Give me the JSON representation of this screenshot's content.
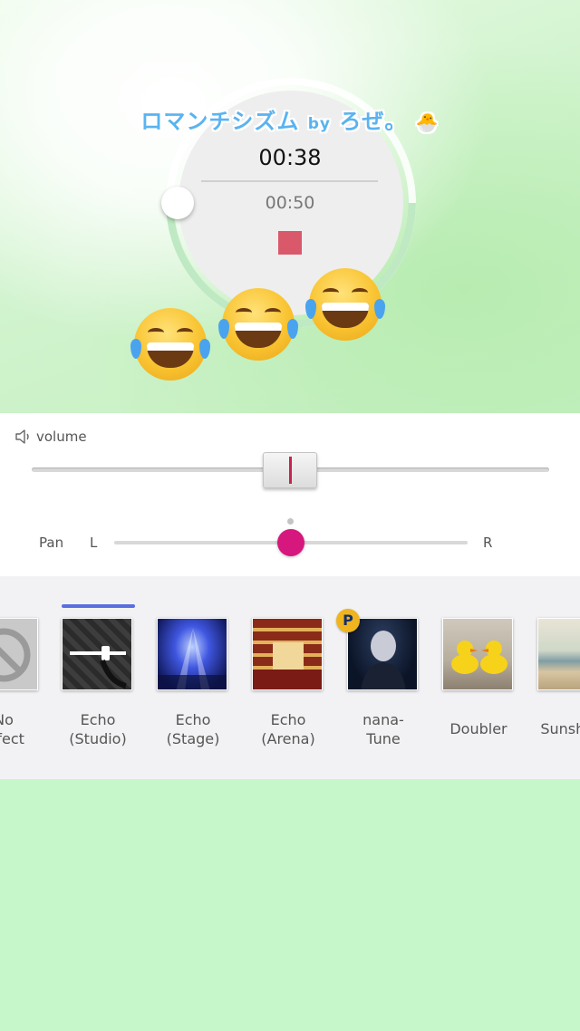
{
  "player": {
    "song_title_main": "ロマンチシズム",
    "song_title_by": "by",
    "song_title_artist": "ろぜ。",
    "song_title_emoji": "🐣",
    "elapsed": "00:38",
    "total": "00:50",
    "progress_fraction": 0.76
  },
  "decorations": {
    "emoji_name": "face-with-tears-of-joy",
    "count": 3
  },
  "controls": {
    "volume_label": "volume",
    "volume_fraction": 0.5,
    "pan_label": "Pan",
    "pan_left": "L",
    "pan_right": "R",
    "pan_fraction": 0.5
  },
  "effects": {
    "selected_index": 1,
    "items": [
      {
        "line1": "No",
        "line2": "effect",
        "icon": "no-effect-icon",
        "premium": false
      },
      {
        "line1": "Echo",
        "line2": "(Studio)",
        "icon": "studio-image",
        "premium": false
      },
      {
        "line1": "Echo",
        "line2": "(Stage)",
        "icon": "stage-image",
        "premium": false
      },
      {
        "line1": "Echo",
        "line2": "(Arena)",
        "icon": "arena-image",
        "premium": false
      },
      {
        "line1": "nana-",
        "line2": "Tune",
        "icon": "nana-tune-image",
        "premium": true
      },
      {
        "line1": "Doubler",
        "line2": "",
        "icon": "ducks-image",
        "premium": false
      },
      {
        "line1": "Sunshine",
        "line2": "",
        "icon": "beach-image",
        "premium": false
      }
    ],
    "premium_badge": "P"
  },
  "colors": {
    "accent_pink": "#d6177e",
    "stop_red": "#d9596b",
    "selection_blue": "#5a6fe0",
    "title_blue": "#5ab3f0",
    "background_green": "#c6f7cb"
  }
}
